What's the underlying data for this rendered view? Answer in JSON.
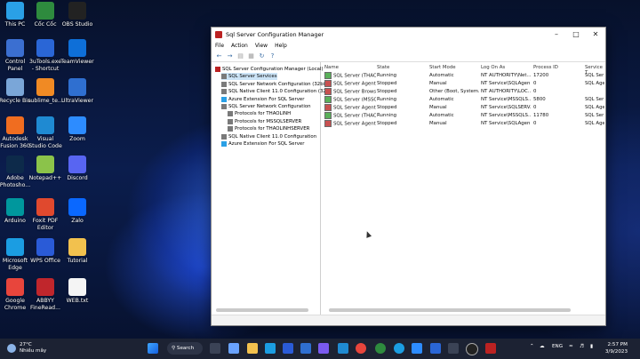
{
  "desktop": {
    "icons": [
      {
        "label": "This PC",
        "icon": "monitor-icon",
        "color": "#2aa0e6"
      },
      {
        "label": "Cốc Cốc",
        "icon": "coccoc-icon",
        "color": "#2e8b3e"
      },
      {
        "label": "OBS Studio",
        "icon": "obs-icon",
        "color": "#222222"
      },
      {
        "label": "Control Panel",
        "icon": "control-panel-icon",
        "color": "#3b6fd1"
      },
      {
        "label": "3uTools.exe - Shortcut",
        "icon": "3utools-icon",
        "color": "#2a66d6"
      },
      {
        "label": "TeamViewer",
        "icon": "teamviewer-icon",
        "color": "#0e6fd8"
      },
      {
        "label": "Recycle Bin",
        "icon": "recycle-bin-icon",
        "color": "#7aa6d8"
      },
      {
        "label": "sublime_te...",
        "icon": "sublime-icon",
        "color": "#f08a24"
      },
      {
        "label": "UltraViewer",
        "icon": "ultraviewer-icon",
        "color": "#2f6fd0"
      },
      {
        "label": "Autodesk Fusion 360",
        "icon": "fusion360-icon",
        "color": "#f06d20"
      },
      {
        "label": "Visual Studio Code",
        "icon": "vscode-icon",
        "color": "#1f8ad2"
      },
      {
        "label": "Zoom",
        "icon": "zoom-icon",
        "color": "#2d8cff"
      },
      {
        "label": "Adobe Photosho...",
        "icon": "photoshop-icon",
        "color": "#0d2a4a"
      },
      {
        "label": "Notepad++",
        "icon": "notepadpp-icon",
        "color": "#8bc34a"
      },
      {
        "label": "Discord",
        "icon": "discord-icon",
        "color": "#5865f2"
      },
      {
        "label": "Arduino",
        "icon": "arduino-icon",
        "color": "#00979d"
      },
      {
        "label": "Foxit PDF Editor",
        "icon": "foxit-icon",
        "color": "#e0492e"
      },
      {
        "label": "Zalo",
        "icon": "zalo-icon",
        "color": "#0a68ff"
      },
      {
        "label": "Microsoft Edge",
        "icon": "edge-icon",
        "color": "#1b9de2"
      },
      {
        "label": "WPS Office",
        "icon": "wps-icon",
        "color": "#2a5bd7"
      },
      {
        "label": "Tutorial",
        "icon": "folder-icon",
        "color": "#f2c14e"
      },
      {
        "label": "Google Chrome",
        "icon": "chrome-icon",
        "color": "#e8453c"
      },
      {
        "label": "ABBYY FineRead...",
        "icon": "abbyy-icon",
        "color": "#c0262c"
      },
      {
        "label": "WEB.txt",
        "icon": "text-file-icon",
        "color": "#f4f4f4"
      }
    ]
  },
  "window": {
    "title": "Sql Server Configuration Manager",
    "menu": [
      "File",
      "Action",
      "View",
      "Help"
    ],
    "tree": [
      {
        "label": "SQL Server Configuration Manager (Local)",
        "level": 0
      },
      {
        "label": "SQL Server Services",
        "level": 1,
        "selected": true
      },
      {
        "label": "SQL Server Network Configuration (32bit)",
        "level": 1
      },
      {
        "label": "SQL Native Client 11.0 Configuration (32b",
        "level": 1
      },
      {
        "label": "Azure Extension For SQL Server",
        "level": 1
      },
      {
        "label": "SQL Server Network Configuration",
        "level": 1
      },
      {
        "label": "Protocols for THAOLINH",
        "level": 2
      },
      {
        "label": "Protocols for MSSQLSERVER",
        "level": 2
      },
      {
        "label": "Protocols for THAOLINHSERVER",
        "level": 2
      },
      {
        "label": "SQL Native Client 11.0 Configuration",
        "level": 1
      },
      {
        "label": "Azure Extension For SQL Server",
        "level": 1
      }
    ],
    "columns": [
      "Name",
      "State",
      "Start Mode",
      "Log On As",
      "Process ID",
      "Service T"
    ],
    "rows": [
      [
        "SQL Server (THAO...",
        "Running",
        "Automatic",
        "NT AUTHORITY\\Net...",
        "17200",
        "SQL Ser"
      ],
      [
        "SQL Server Agent ...",
        "Stopped",
        "Manual",
        "NT Service\\SQLAgen...",
        "0",
        "SQL Age"
      ],
      [
        "SQL Server Browser",
        "Stopped",
        "Other (Boot, System...",
        "NT AUTHORITY\\LOC...",
        "0",
        ""
      ],
      [
        "SQL Server (MSSQL...",
        "Running",
        "Automatic",
        "NT Service\\MSSQLS...",
        "5800",
        "SQL Ser"
      ],
      [
        "SQL Server Agent ...",
        "Stopped",
        "Manual",
        "NT Service\\SQLSERV...",
        "0",
        "SQL Age"
      ],
      [
        "SQL Server (THAO...",
        "Running",
        "Automatic",
        "NT Service\\MSSQLS...",
        "11780",
        "SQL Ser"
      ],
      [
        "SQL Server Agent ...",
        "Stopped",
        "Manual",
        "NT Service\\SQLAgen...",
        "0",
        "SQL Age"
      ]
    ]
  },
  "taskbar": {
    "weather_temp": "27°C",
    "weather_desc": "Nhiều mây",
    "search_label": "Search",
    "lang": "ENG",
    "time": "2:57 PM",
    "date": "3/9/2023"
  },
  "colors": {
    "accent": "#0a68ff",
    "selection": "#cce4f7"
  }
}
